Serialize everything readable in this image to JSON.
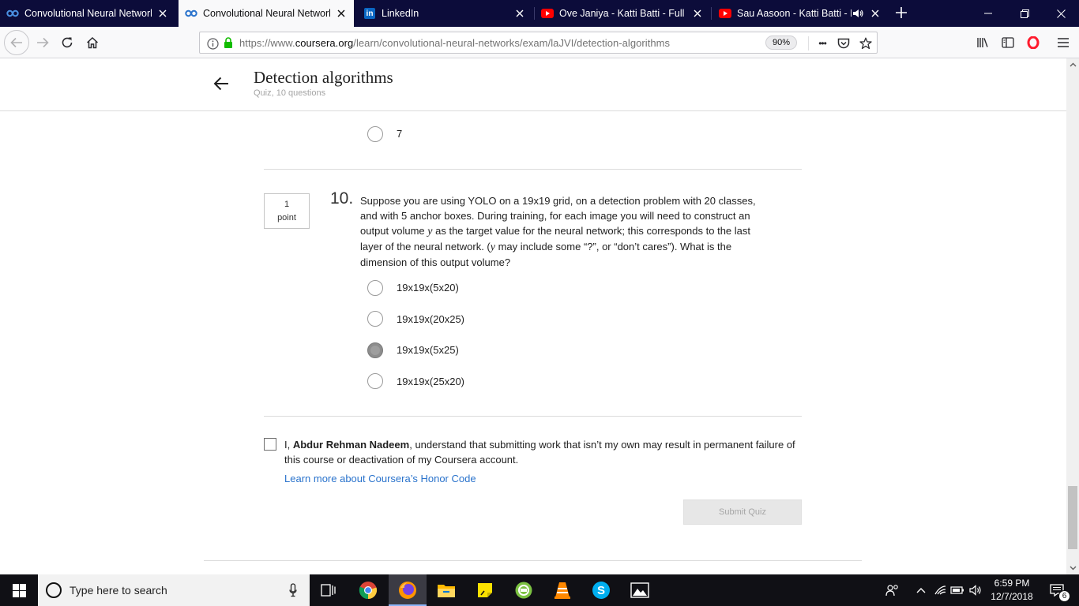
{
  "browser": {
    "tabs": [
      {
        "title": "Convolutional Neural Networks",
        "favicon": "coursera-icon",
        "active": false
      },
      {
        "title": "Convolutional Neural Networks",
        "favicon": "coursera-icon",
        "active": true
      },
      {
        "title": "LinkedIn",
        "favicon": "linkedin-icon",
        "active": false
      },
      {
        "title": "Ove Janiya - Katti Batti - Full Video",
        "favicon": "youtube-icon",
        "active": false
      },
      {
        "title": "Sau Aasoon - Katti Batti - Full Video",
        "favicon": "youtube-icon",
        "active": false,
        "playing_audio": true
      }
    ],
    "linkedin_glyph": "in",
    "url_prefix": "https://www.",
    "url_domain": "coursera.org",
    "url_path": "/learn/convolutional-neural-networks/exam/laJVI/detection-algorithms",
    "zoom": "90%",
    "overflow_glyph": "•••"
  },
  "quiz": {
    "title": "Detection algorithms",
    "subtitle": "Quiz, 10 questions",
    "prev_question_last_option": "7",
    "question": {
      "number": "10.",
      "points_value": "1",
      "points_label": "point",
      "text_1": "Suppose you are using YOLO on a 19x19 grid, on a detection problem with 20 classes, and with 5 anchor boxes. During training, for each image you will need to construct an output volume ",
      "var_y": "y",
      "text_2": " as the target value for the neural network; this corresponds to the last layer of the neural network. (",
      "text_3": " may include some “?”, or “don’t cares”). What is the dimension of this output volume?",
      "options": [
        "19x19x(5x20)",
        "19x19x(20x25)",
        "19x19x(5x25)",
        "19x19x(25x20)"
      ],
      "selected_index": 2
    },
    "honor_prefix": "I, ",
    "honor_name": "Abdur Rehman Nadeem",
    "honor_suffix": ", understand that submitting work that isn’t my own may result in permanent failure of this course or deactivation of my Coursera account.",
    "honor_link": "Learn more about Coursera’s Honor Code",
    "submit_label": "Submit Quiz"
  },
  "taskbar": {
    "search_placeholder": "Type here to search",
    "time": "6:59 PM",
    "date": "12/7/2018",
    "notification_count": "6",
    "skype_glyph": "S"
  },
  "colors": {
    "tabstrip": "#0c0c3a",
    "link": "#2a73cc",
    "selected_radio": "#8d8d8d"
  }
}
